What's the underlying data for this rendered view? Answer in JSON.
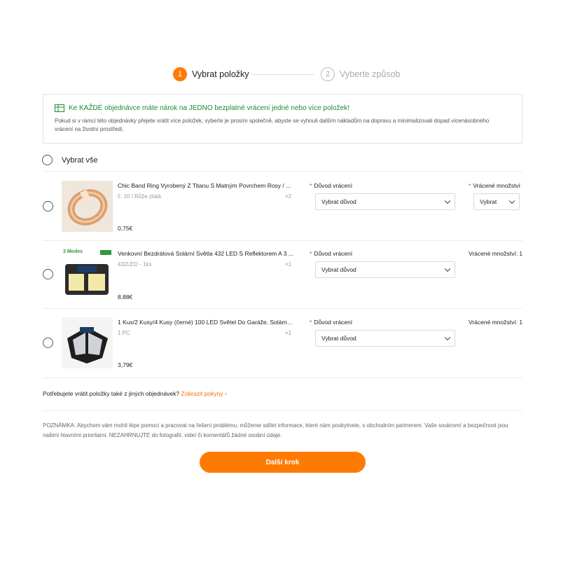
{
  "stepper": {
    "step1": {
      "number": "1",
      "label": "Vybrat položky",
      "active": true
    },
    "step2": {
      "number": "2",
      "label": "Vyberte způsob",
      "active": false
    }
  },
  "notice": {
    "icon": "gift-icon",
    "title": "Ke KAŽDÉ objednávce máte nárok na JEDNO bezplatné vrácení jedné nebo více položek!",
    "text": "Pokud si v rámci této objednávky přejete vrátit více položek, vyberte je prosím společně, abyste se vyhnuli dalším nákladům na dopravu a minimalizovali dopad vícenásobného vrácení na životní prostředí."
  },
  "select_all": {
    "label": "Vybrat vše"
  },
  "items": [
    {
      "title": "Chic Band Ring Vyrobený Z Titanu S Matným Povrchem Rosy / ...",
      "variant": "č. 10 / Růže zlatá",
      "qty": "×2",
      "price": "0,75€",
      "reason_label": "Důvod vrácení",
      "reason_value": "Vybrat důvod",
      "qty_label": "Vrácené množství",
      "qty_value": "Vybrat"
    },
    {
      "title": "Venkovní Bezdrátová Solární Světla 432 LED S Reflektorem A 3 ...",
      "variant": "432LED - 1ks",
      "qty": "×1",
      "price": "8,88€",
      "reason_label": "Důvod vrácení",
      "reason_value": "Vybrat důvod",
      "qty_label": "Vrácené množství: 1",
      "thumb_badge": "3 Modes"
    },
    {
      "title": "1 Kus/2 Kusy/4 Kusy (černé) 100 LED Světel Do Garáže, Solární ...",
      "variant": "1 PC",
      "qty": "×1",
      "price": "3,79€",
      "reason_label": "Důvod vrácení",
      "reason_value": "Vybrat důvod",
      "qty_label": "Vrácené množství: 1"
    }
  ],
  "other_orders": {
    "text": "Potřebujete vrátit položky také z jiných objednávek?",
    "link": "Zobrazit pokyny"
  },
  "note": "POZNÁMKA: Abychom vám mohli lépe pomoci a pracovat na řešení problému, můžeme sdílet informace, které nám poskytnete, s obchodním partnerem. Vaše soukromí a bezpečnost jsou našimi hlavními prioritami. NEZAHRNUJTE do fotografií, videí či komentářů žádné osobní údaje.",
  "next_button": {
    "label": "Další krok"
  },
  "colors": {
    "accent": "#ff7a00",
    "notice_green": "#1a8d2d",
    "required_star": "#e4393c"
  }
}
